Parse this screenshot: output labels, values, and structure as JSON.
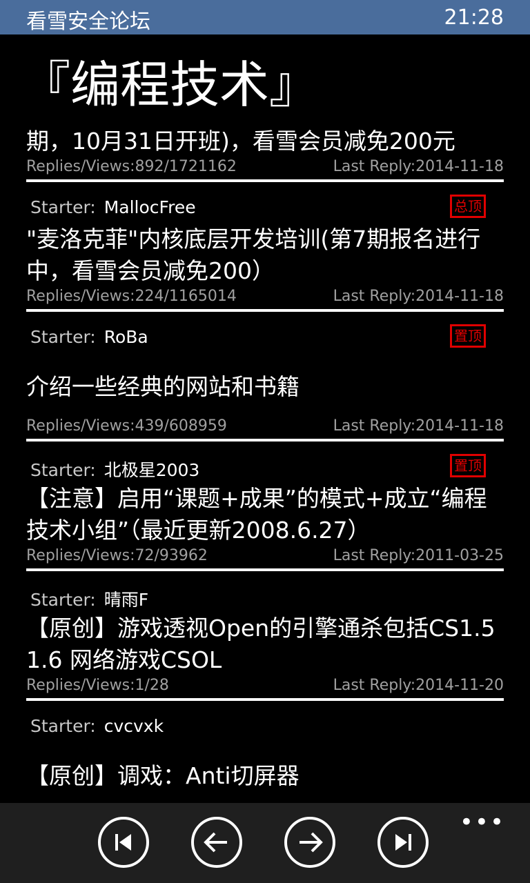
{
  "status_bar": {
    "app_title": "看雪安全论坛",
    "time": "21:28"
  },
  "page_title": "『编程技术』",
  "posts": [
    {
      "title": "期，10月31日开班)，看雪会员减免200元",
      "replies_views": "Replies/Views:892/1721162",
      "last_reply": "Last Reply:2014-11-18"
    },
    {
      "starter_label": "Starter:",
      "starter": "MallocFree",
      "badge": "总顶",
      "title": "\"麦洛克菲\"内核底层开发培训(第7期报名进行中，看雪会员减免200）",
      "replies_views": "Replies/Views:224/1165014",
      "last_reply": "Last Reply:2014-11-18"
    },
    {
      "starter_label": "Starter:",
      "starter": "RoBa",
      "badge": "置顶",
      "title": "介绍一些经典的网站和书籍",
      "replies_views": "Replies/Views:439/608959",
      "last_reply": "Last Reply:2014-11-18"
    },
    {
      "starter_label": "Starter:",
      "starter": "北极星2003",
      "badge": "置顶",
      "title": "【注意】启用“课题+成果”的模式+成立“编程技术小组”（最近更新2008.6.27）",
      "replies_views": "Replies/Views:72/93962",
      "last_reply": "Last Reply:2011-03-25"
    },
    {
      "starter_label": "Starter:",
      "starter": "晴雨F",
      "title": "【原创】游戏透视Open的引擎通杀包括CS1.5 1.6 网络游戏CSOL",
      "replies_views": "Replies/Views:1/28",
      "last_reply": "Last Reply:2014-11-20"
    },
    {
      "starter_label": "Starter:",
      "starter": "cvcvxk",
      "title": "【原创】调戏：Anti切屏器"
    }
  ],
  "app_bar": {
    "buttons": [
      "first-page",
      "previous-page",
      "next-page",
      "last-page"
    ],
    "more": "•••"
  },
  "colors": {
    "status_bar": "#4a6d9c",
    "badge": "#e00000",
    "background": "#000000"
  }
}
